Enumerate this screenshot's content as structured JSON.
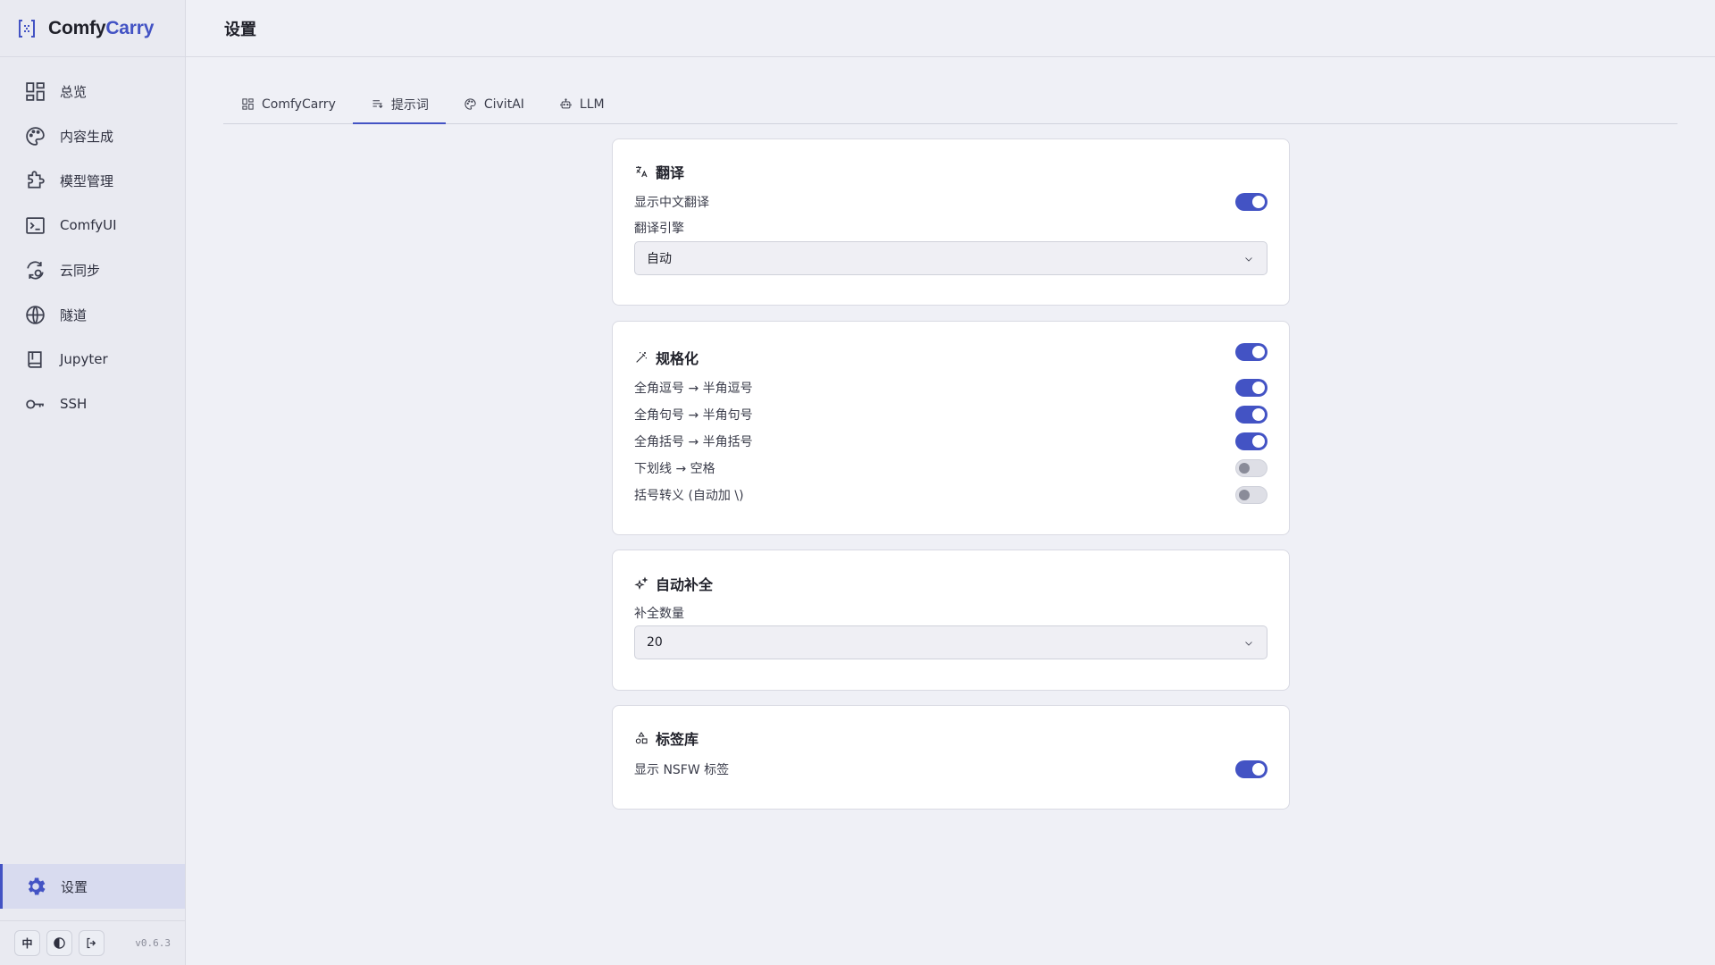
{
  "brand": {
    "part1": "Comfy",
    "part2": "Carry"
  },
  "nav": [
    {
      "label": "总览",
      "icon": "dashboard-icon"
    },
    {
      "label": "内容生成",
      "icon": "palette-icon"
    },
    {
      "label": "模型管理",
      "icon": "puzzle-icon"
    },
    {
      "label": "ComfyUI",
      "icon": "terminal-icon"
    },
    {
      "label": "云同步",
      "icon": "sync-icon"
    },
    {
      "label": "隧道",
      "icon": "globe-icon"
    },
    {
      "label": "Jupyter",
      "icon": "book-icon"
    },
    {
      "label": "SSH",
      "icon": "key-icon"
    }
  ],
  "nav_active": {
    "label": "设置",
    "icon": "gear-icon"
  },
  "footer": {
    "lang_label": "中",
    "version": "v0.6.3"
  },
  "header": {
    "title": "设置"
  },
  "tabs": [
    {
      "label": "ComfyCarry",
      "icon": "dashboard-icon"
    },
    {
      "label": "提示词",
      "icon": "prompt-icon",
      "active": true
    },
    {
      "label": "CivitAI",
      "icon": "palette-icon"
    },
    {
      "label": "LLM",
      "icon": "robot-icon"
    }
  ],
  "translation": {
    "title": "翻译",
    "show_label": "显示中文翻译",
    "show_on": true,
    "engine_label": "翻译引擎",
    "engine_value": "自动"
  },
  "normalize": {
    "title": "规格化",
    "enabled": true,
    "rows": [
      {
        "label": "全角逗号 → 半角逗号",
        "on": true
      },
      {
        "label": "全角句号 → 半角句号",
        "on": true
      },
      {
        "label": "全角括号 → 半角括号",
        "on": true
      },
      {
        "label": "下划线 → 空格",
        "on": false
      },
      {
        "label": "括号转义 (自动加 \\)",
        "on": false
      }
    ]
  },
  "autocomplete": {
    "title": "自动补全",
    "count_label": "补全数量",
    "count_value": "20"
  },
  "tags": {
    "title": "标签库",
    "nsfw_label": "显示 NSFW 标签",
    "nsfw_on": true
  },
  "colors": {
    "accent": "#4353c4",
    "background": "#eff0f6",
    "sidebar": "#e9eaf1"
  }
}
